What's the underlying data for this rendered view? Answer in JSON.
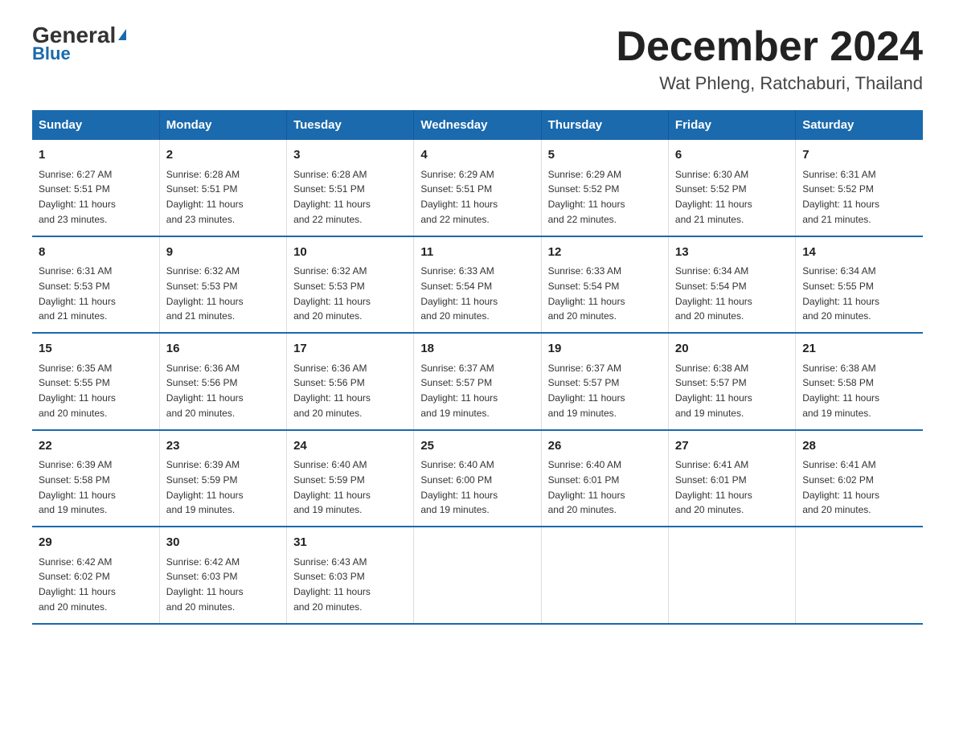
{
  "logo": {
    "text": "General",
    "blue": "Blue"
  },
  "header": {
    "month": "December 2024",
    "location": "Wat Phleng, Ratchaburi, Thailand"
  },
  "weekdays": [
    "Sunday",
    "Monday",
    "Tuesday",
    "Wednesday",
    "Thursday",
    "Friday",
    "Saturday"
  ],
  "weeks": [
    [
      {
        "day": "1",
        "sunrise": "6:27 AM",
        "sunset": "5:51 PM",
        "daylight": "11 hours and 23 minutes."
      },
      {
        "day": "2",
        "sunrise": "6:28 AM",
        "sunset": "5:51 PM",
        "daylight": "11 hours and 23 minutes."
      },
      {
        "day": "3",
        "sunrise": "6:28 AM",
        "sunset": "5:51 PM",
        "daylight": "11 hours and 22 minutes."
      },
      {
        "day": "4",
        "sunrise": "6:29 AM",
        "sunset": "5:51 PM",
        "daylight": "11 hours and 22 minutes."
      },
      {
        "day": "5",
        "sunrise": "6:29 AM",
        "sunset": "5:52 PM",
        "daylight": "11 hours and 22 minutes."
      },
      {
        "day": "6",
        "sunrise": "6:30 AM",
        "sunset": "5:52 PM",
        "daylight": "11 hours and 21 minutes."
      },
      {
        "day": "7",
        "sunrise": "6:31 AM",
        "sunset": "5:52 PM",
        "daylight": "11 hours and 21 minutes."
      }
    ],
    [
      {
        "day": "8",
        "sunrise": "6:31 AM",
        "sunset": "5:53 PM",
        "daylight": "11 hours and 21 minutes."
      },
      {
        "day": "9",
        "sunrise": "6:32 AM",
        "sunset": "5:53 PM",
        "daylight": "11 hours and 21 minutes."
      },
      {
        "day": "10",
        "sunrise": "6:32 AM",
        "sunset": "5:53 PM",
        "daylight": "11 hours and 20 minutes."
      },
      {
        "day": "11",
        "sunrise": "6:33 AM",
        "sunset": "5:54 PM",
        "daylight": "11 hours and 20 minutes."
      },
      {
        "day": "12",
        "sunrise": "6:33 AM",
        "sunset": "5:54 PM",
        "daylight": "11 hours and 20 minutes."
      },
      {
        "day": "13",
        "sunrise": "6:34 AM",
        "sunset": "5:54 PM",
        "daylight": "11 hours and 20 minutes."
      },
      {
        "day": "14",
        "sunrise": "6:34 AM",
        "sunset": "5:55 PM",
        "daylight": "11 hours and 20 minutes."
      }
    ],
    [
      {
        "day": "15",
        "sunrise": "6:35 AM",
        "sunset": "5:55 PM",
        "daylight": "11 hours and 20 minutes."
      },
      {
        "day": "16",
        "sunrise": "6:36 AM",
        "sunset": "5:56 PM",
        "daylight": "11 hours and 20 minutes."
      },
      {
        "day": "17",
        "sunrise": "6:36 AM",
        "sunset": "5:56 PM",
        "daylight": "11 hours and 20 minutes."
      },
      {
        "day": "18",
        "sunrise": "6:37 AM",
        "sunset": "5:57 PM",
        "daylight": "11 hours and 19 minutes."
      },
      {
        "day": "19",
        "sunrise": "6:37 AM",
        "sunset": "5:57 PM",
        "daylight": "11 hours and 19 minutes."
      },
      {
        "day": "20",
        "sunrise": "6:38 AM",
        "sunset": "5:57 PM",
        "daylight": "11 hours and 19 minutes."
      },
      {
        "day": "21",
        "sunrise": "6:38 AM",
        "sunset": "5:58 PM",
        "daylight": "11 hours and 19 minutes."
      }
    ],
    [
      {
        "day": "22",
        "sunrise": "6:39 AM",
        "sunset": "5:58 PM",
        "daylight": "11 hours and 19 minutes."
      },
      {
        "day": "23",
        "sunrise": "6:39 AM",
        "sunset": "5:59 PM",
        "daylight": "11 hours and 19 minutes."
      },
      {
        "day": "24",
        "sunrise": "6:40 AM",
        "sunset": "5:59 PM",
        "daylight": "11 hours and 19 minutes."
      },
      {
        "day": "25",
        "sunrise": "6:40 AM",
        "sunset": "6:00 PM",
        "daylight": "11 hours and 19 minutes."
      },
      {
        "day": "26",
        "sunrise": "6:40 AM",
        "sunset": "6:01 PM",
        "daylight": "11 hours and 20 minutes."
      },
      {
        "day": "27",
        "sunrise": "6:41 AM",
        "sunset": "6:01 PM",
        "daylight": "11 hours and 20 minutes."
      },
      {
        "day": "28",
        "sunrise": "6:41 AM",
        "sunset": "6:02 PM",
        "daylight": "11 hours and 20 minutes."
      }
    ],
    [
      {
        "day": "29",
        "sunrise": "6:42 AM",
        "sunset": "6:02 PM",
        "daylight": "11 hours and 20 minutes."
      },
      {
        "day": "30",
        "sunrise": "6:42 AM",
        "sunset": "6:03 PM",
        "daylight": "11 hours and 20 minutes."
      },
      {
        "day": "31",
        "sunrise": "6:43 AM",
        "sunset": "6:03 PM",
        "daylight": "11 hours and 20 minutes."
      },
      null,
      null,
      null,
      null
    ]
  ],
  "labels": {
    "sunrise": "Sunrise:",
    "sunset": "Sunset:",
    "daylight": "Daylight:"
  }
}
